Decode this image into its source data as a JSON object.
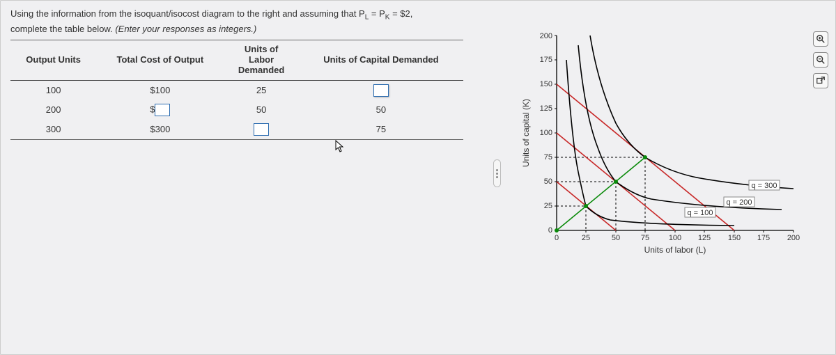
{
  "prompt": {
    "line1_a": "Using the information from the isoquant/isocost diagram to the right and assuming that P",
    "line1_sub1": "L",
    "line1_b": " = P",
    "line1_sub2": "K",
    "line1_c": " = $2,",
    "line2_a": "complete the table below. ",
    "line2_em": "(Enter your responses as integers.)"
  },
  "table": {
    "headers": {
      "c1": "Output Units",
      "c2": "Total Cost of Output",
      "c3_a": "Units of",
      "c3_b": "Labor",
      "c3_c": "Demanded",
      "c4": "Units of Capital Demanded"
    },
    "rows": [
      {
        "output": "100",
        "cost": "$100",
        "labor": "25",
        "capital_input": true,
        "capital": ""
      },
      {
        "output": "200",
        "cost_prefix": "$",
        "cost_input": true,
        "labor": "50",
        "capital": "50"
      },
      {
        "output": "300",
        "cost": "$300",
        "labor_input": true,
        "labor": "",
        "capital": "75"
      }
    ]
  },
  "chart": {
    "ylabel": "Units of capital (K)",
    "xlabel": "Units of labor (L)",
    "xticks": [
      "0",
      "25",
      "50",
      "75",
      "100",
      "125",
      "150",
      "175",
      "200"
    ],
    "yticks": [
      "0",
      "25",
      "50",
      "75",
      "100",
      "125",
      "150",
      "175",
      "200"
    ],
    "curve_labels": {
      "q100": "q = 100",
      "q200": "q = 200",
      "q300": "q = 300"
    }
  },
  "tools": {
    "zoom_in": "zoom-in",
    "zoom_out": "zoom-out",
    "popout": "popout"
  },
  "chart_data": {
    "type": "line",
    "title": "Isoquant / Isocost Diagram",
    "xlabel": "Units of labor (L)",
    "ylabel": "Units of capital (K)",
    "xlim": [
      0,
      200
    ],
    "ylim": [
      0,
      200
    ],
    "series": [
      {
        "name": "isocost q=100 budget",
        "type": "line",
        "color": "#c82828",
        "points": [
          [
            0,
            50
          ],
          [
            50,
            0
          ]
        ]
      },
      {
        "name": "isocost q=200 budget",
        "type": "line",
        "color": "#c82828",
        "points": [
          [
            0,
            100
          ],
          [
            100,
            0
          ]
        ]
      },
      {
        "name": "isocost q=300 budget",
        "type": "line",
        "color": "#c82828",
        "points": [
          [
            0,
            150
          ],
          [
            150,
            0
          ]
        ]
      },
      {
        "name": "isoquant q=100",
        "type": "curve",
        "color": "#000",
        "points": [
          [
            8,
            175
          ],
          [
            12,
            110
          ],
          [
            18,
            60
          ],
          [
            25,
            25
          ],
          [
            45,
            14
          ],
          [
            90,
            8
          ],
          [
            150,
            5
          ]
        ]
      },
      {
        "name": "isoquant q=200",
        "type": "curve",
        "color": "#000",
        "points": [
          [
            18,
            190
          ],
          [
            25,
            135
          ],
          [
            35,
            85
          ],
          [
            50,
            50
          ],
          [
            80,
            32
          ],
          [
            130,
            22
          ],
          [
            190,
            17
          ]
        ]
      },
      {
        "name": "isoquant q=300",
        "type": "curve",
        "color": "#000",
        "points": [
          [
            28,
            200
          ],
          [
            35,
            165
          ],
          [
            50,
            110
          ],
          [
            75,
            75
          ],
          [
            110,
            55
          ],
          [
            160,
            42
          ],
          [
            200,
            37
          ]
        ]
      },
      {
        "name": "expansion path",
        "type": "line",
        "color": "#0a8a0a",
        "points": [
          [
            0,
            0
          ],
          [
            25,
            25
          ],
          [
            50,
            50
          ],
          [
            75,
            75
          ]
        ]
      }
    ],
    "tangency_points": [
      {
        "L": 25,
        "K": 25,
        "q": 100
      },
      {
        "L": 50,
        "K": 50,
        "q": 200
      },
      {
        "L": 75,
        "K": 75,
        "q": 300
      }
    ]
  }
}
